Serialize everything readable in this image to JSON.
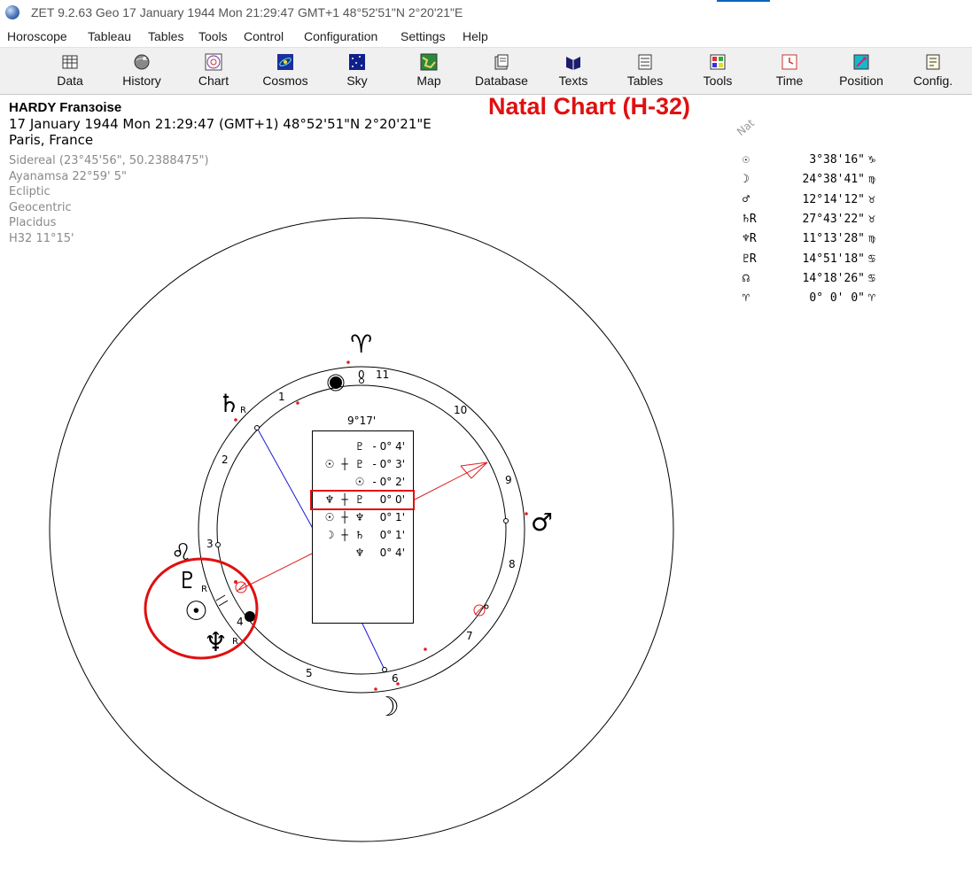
{
  "window": {
    "title": "ZET 9.2.63 Geo   17 January 1944  Mon  21:29:47 GMT+1 48°52'51\"N  2°20'21\"E"
  },
  "menu": [
    "Horoscope",
    "Tableau",
    "Tables",
    "Tools",
    "Control",
    "Configuration",
    "Settings",
    "Help"
  ],
  "toolbar": [
    {
      "label": "Data",
      "icon": "data-grid-icon"
    },
    {
      "label": "History",
      "icon": "history-globe-icon"
    },
    {
      "label": "Chart",
      "icon": "chart-wheel-icon"
    },
    {
      "label": "Cosmos",
      "icon": "cosmos-icon"
    },
    {
      "label": "Sky",
      "icon": "sky-stars-icon"
    },
    {
      "label": "Map",
      "icon": "map-icon"
    },
    {
      "label": "Database",
      "icon": "database-icon"
    },
    {
      "label": "Texts",
      "icon": "texts-icon"
    },
    {
      "label": "Tables",
      "icon": "tables-icon"
    },
    {
      "label": "Tools",
      "icon": "tools-icon"
    },
    {
      "label": "Time",
      "icon": "time-icon"
    },
    {
      "label": "Position",
      "icon": "position-icon"
    },
    {
      "label": "Config.",
      "icon": "config-icon"
    }
  ],
  "person": {
    "name": "HARDY Franзoise",
    "dateline": "17 January 1944  Mon  21:29:47 (GMT+1) 48°52'51\"N  2°20'21\"E",
    "place": "Paris, France"
  },
  "settings": [
    "Sidereal (23°45'56\", 50.2388475\")",
    "Ayanamsa 22°59' 5\"",
    "Ecliptic",
    "Geocentric",
    "Placidus",
    "H32  11°15'"
  ],
  "chart_title": "Natal Chart (H-32)",
  "positions": {
    "header": "Nat",
    "rows": [
      {
        "glyph": "☉",
        "value": "3°38'16\"",
        "sign": "♑",
        "icon": "sun-icon"
      },
      {
        "glyph": "☽",
        "value": "24°38'41\"",
        "sign": "♍",
        "icon": "moon-icon"
      },
      {
        "glyph": "♂",
        "value": "12°14'12\"",
        "sign": "♉",
        "icon": "mars-icon"
      },
      {
        "glyph": "♄R",
        "value": "27°43'22\"",
        "sign": "♉",
        "icon": "saturn-icon"
      },
      {
        "glyph": "♆R",
        "value": "11°13'28\"",
        "sign": "♍",
        "icon": "neptune-icon"
      },
      {
        "glyph": "♇R",
        "value": "14°51'18\"",
        "sign": "♋",
        "icon": "pluto-icon"
      },
      {
        "glyph": "☊",
        "value": "14°18'26\"",
        "sign": "♋",
        "icon": "node-icon"
      },
      {
        "glyph": "♈",
        "value": "0° 0' 0\"",
        "sign": "♈",
        "icon": "aries-point-icon"
      }
    ]
  },
  "aspects": {
    "header": "9°17'",
    "rows": [
      {
        "a": "",
        "b": "♇",
        "value": "- 0° 4'"
      },
      {
        "a": "☉",
        "b": "♇",
        "value": "- 0° 3'"
      },
      {
        "a": "",
        "b": "☉",
        "value": "- 0° 2'"
      },
      {
        "a": "♆",
        "b": "♇",
        "value": "0° 0'"
      },
      {
        "a": "☉",
        "b": "♆",
        "value": "0° 1'"
      },
      {
        "a": "☽",
        "b": "♄",
        "value": "0° 1'"
      },
      {
        "a": "",
        "b": "♆",
        "value": "0° 4'"
      }
    ]
  },
  "wheel": {
    "house_numbers": [
      "1",
      "2",
      "3",
      "4",
      "5",
      "6",
      "7",
      "8",
      "9",
      "10",
      "11",
      "0"
    ],
    "planet_glyphs": {
      "aries": "♈",
      "saturn": "♄",
      "retro": "R",
      "mars": "♂",
      "leo": "♌",
      "pluto": "♇",
      "sun": "☉",
      "neptune": "♆",
      "moon": "☽"
    }
  }
}
